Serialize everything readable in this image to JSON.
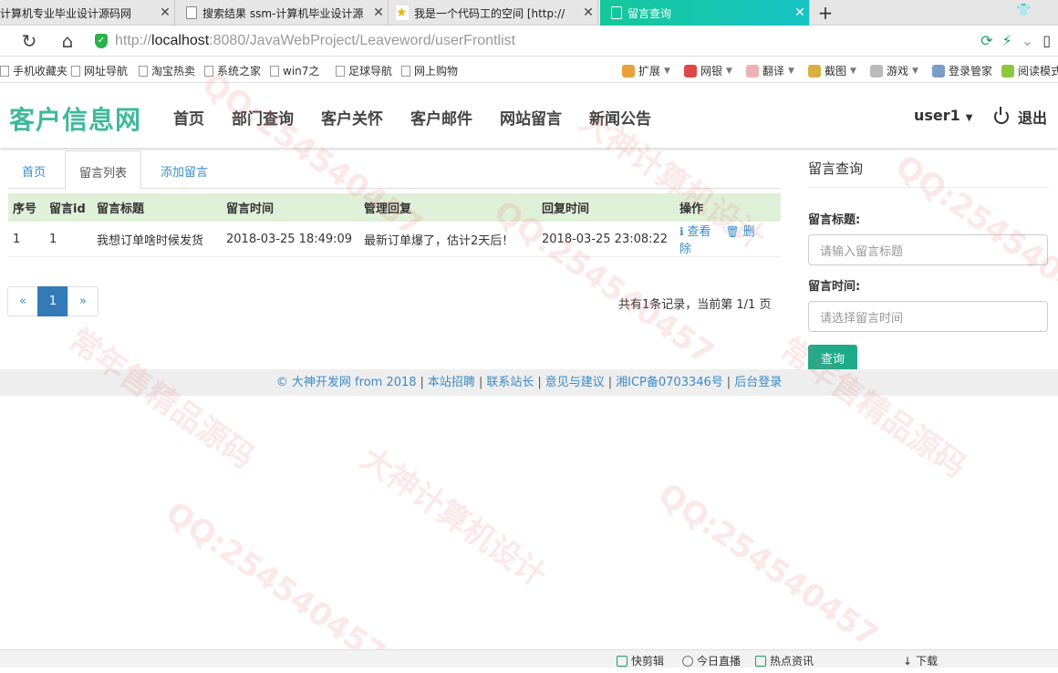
{
  "browser": {
    "tabs": [
      {
        "title": "计算机专业毕业设计源码网",
        "active": false
      },
      {
        "title": "搜索结果 ssm-计算机毕业设计源",
        "active": false
      },
      {
        "title": "我是一个代码工的空间 [http://",
        "active": false
      },
      {
        "title": "留言查询",
        "active": true
      }
    ],
    "new_tab": "+",
    "url_prefix": "http://",
    "url_host": "localhost",
    "url_rest": ":8080/JavaWebProject/Leaveword/userFrontlist"
  },
  "bookmarks": {
    "left": [
      "手机收藏夹",
      "网址导航",
      "淘宝热卖",
      "系统之家",
      "win7之",
      "足球导航",
      "网上购物"
    ],
    "right": [
      "扩展",
      "网银",
      "翻译",
      "截图",
      "游戏",
      "登录管家",
      "阅读模式"
    ]
  },
  "site": {
    "logo": "客户信息网",
    "nav": [
      "首页",
      "部门查询",
      "客户关怀",
      "客户邮件",
      "网站留言",
      "新闻公告"
    ],
    "user": "user1",
    "logout": "退出"
  },
  "content_tabs": [
    "首页",
    "留言列表",
    "添加留言"
  ],
  "table": {
    "headers": [
      "序号",
      "留言id",
      "留言标题",
      "留言时间",
      "管理回复",
      "回复时间",
      "操作"
    ],
    "rows": [
      {
        "no": "1",
        "id": "1",
        "title": "我想订单啥时候发货",
        "time": "2018-03-25 18:49:09",
        "reply": "最新订单爆了，估计2天后！",
        "reply_time": "2018-03-25 23:08:22",
        "view": "查看",
        "delete": "删除"
      }
    ]
  },
  "pagination": {
    "prev": "«",
    "current": "1",
    "next": "»",
    "info": "共有1条记录，当前第 1/1 页"
  },
  "search_panel": {
    "title": "留言查询",
    "title_label": "留言标题:",
    "title_placeholder": "请输入留言标题",
    "time_label": "留言时间:",
    "time_placeholder": "请选择留言时间",
    "button": "查询"
  },
  "footer": {
    "items": [
      "© 大神开发网 from 2018",
      "本站招聘",
      "联系站长",
      "意见与建议",
      "湘ICP备0703346号",
      "后台登录"
    ],
    "separator": "|"
  },
  "statusbar": [
    "快剪辑",
    "今日直播",
    "热点资讯",
    "下载"
  ],
  "watermark": [
    "QQ:254540457",
    "大神计算机设计",
    "常年售精品源码"
  ],
  "colors": {
    "brand": "#3fb99b",
    "active_tab": "#16c79a",
    "link": "#3a8cc8",
    "table_header": "#dff0d8",
    "search_button": "#1fab89",
    "page_active": "#337ab7"
  }
}
